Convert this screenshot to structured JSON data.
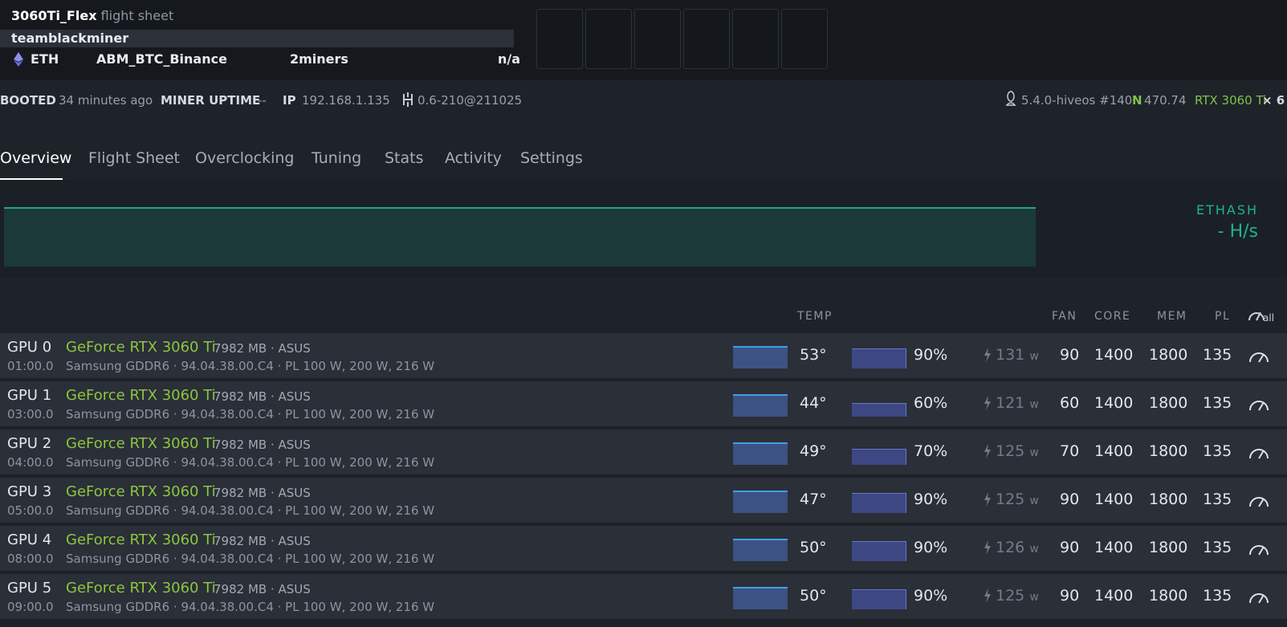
{
  "header": {
    "rig_name": "3060Ti_Flex",
    "title_suffix": " flight sheet",
    "miner": "teamblackminer",
    "coin": "ETH",
    "wallet": "ABM_BTC_Binance",
    "pool": "2miners",
    "status": "n/a",
    "slot_count": 6
  },
  "info": {
    "booted_label": "BOOTED",
    "booted_value": "34 minutes ago",
    "uptime_label": "MINER UPTIME",
    "uptime_value": "--",
    "ip_label": "IP",
    "ip_value": "192.168.1.135",
    "version": "0.6-210@211025",
    "kernel": "5.4.0-hiveos #140",
    "driver_prefix": "N",
    "driver": "470.74",
    "gpu_model": "RTX 3060 Ti",
    "gpu_count": "× 6"
  },
  "tabs": [
    "Overview",
    "Flight Sheet",
    "Overclocking",
    "Tuning",
    "Stats",
    "Activity",
    "Settings"
  ],
  "active_tab": "Overview",
  "hashrate": {
    "algo": "ETHASH",
    "value": "- H/s"
  },
  "table_headers": {
    "temp": "TEMP",
    "fan": "FAN",
    "core": "CORE",
    "mem": "MEM",
    "pl": "PL",
    "all": "all"
  },
  "gpus": [
    {
      "id": "GPU 0",
      "bus": "01:00.0",
      "model": "GeForce RTX 3060 Ti",
      "mem": "7982 MB · ASUS",
      "sub": "Samsung GDDR6 · 94.04.38.00.C4 · PL 100 W, 200 W, 216 W",
      "temp": "53°",
      "fan_pct": "90%",
      "fan_fill": 0.9,
      "watts": "131",
      "unit": "w",
      "fan": "90",
      "core": "1400",
      "memclk": "1800",
      "pl": "135"
    },
    {
      "id": "GPU 1",
      "bus": "03:00.0",
      "model": "GeForce RTX 3060 Ti",
      "mem": "7982 MB · ASUS",
      "sub": "Samsung GDDR6 · 94.04.38.00.C4 · PL 100 W, 200 W, 216 W",
      "temp": "44°",
      "fan_pct": "60%",
      "fan_fill": 0.6,
      "watts": "121",
      "unit": "w",
      "fan": "60",
      "core": "1400",
      "memclk": "1800",
      "pl": "135"
    },
    {
      "id": "GPU 2",
      "bus": "04:00.0",
      "model": "GeForce RTX 3060 Ti",
      "mem": "7982 MB · ASUS",
      "sub": "Samsung GDDR6 · 94.04.38.00.C4 · PL 100 W, 200 W, 216 W",
      "temp": "49°",
      "fan_pct": "70%",
      "fan_fill": 0.7,
      "watts": "125",
      "unit": "w",
      "fan": "70",
      "core": "1400",
      "memclk": "1800",
      "pl": "135"
    },
    {
      "id": "GPU 3",
      "bus": "05:00.0",
      "model": "GeForce RTX 3060 Ti",
      "mem": "7982 MB · ASUS",
      "sub": "Samsung GDDR6 · 94.04.38.00.C4 · PL 100 W, 200 W, 216 W",
      "temp": "47°",
      "fan_pct": "90%",
      "fan_fill": 0.9,
      "watts": "125",
      "unit": "w",
      "fan": "90",
      "core": "1400",
      "memclk": "1800",
      "pl": "135"
    },
    {
      "id": "GPU 4",
      "bus": "08:00.0",
      "model": "GeForce RTX 3060 Ti",
      "mem": "7982 MB · ASUS",
      "sub": "Samsung GDDR6 · 94.04.38.00.C4 · PL 100 W, 200 W, 216 W",
      "temp": "50°",
      "fan_pct": "90%",
      "fan_fill": 0.9,
      "watts": "126",
      "unit": "w",
      "fan": "90",
      "core": "1400",
      "memclk": "1800",
      "pl": "135"
    },
    {
      "id": "GPU 5",
      "bus": "09:00.0",
      "model": "GeForce RTX 3060 Ti",
      "mem": "7982 MB · ASUS",
      "sub": "Samsung GDDR6 · 94.04.38.00.C4 · PL 100 W, 200 W, 216 W",
      "temp": "50°",
      "fan_pct": "90%",
      "fan_fill": 0.9,
      "watts": "125",
      "unit": "w",
      "fan": "90",
      "core": "1400",
      "memclk": "1800",
      "pl": "135"
    }
  ],
  "colors": {
    "accent_green": "#8cc63f",
    "hash_teal": "#1fb38f",
    "temp_bar": "#3d5284",
    "fan_bar": "#3c4784"
  },
  "icons": {
    "coin": "ethereum-icon",
    "kernel": "linux-icon",
    "version": "hive-icon",
    "power": "lightning-icon",
    "oc": "gauge-icon"
  }
}
